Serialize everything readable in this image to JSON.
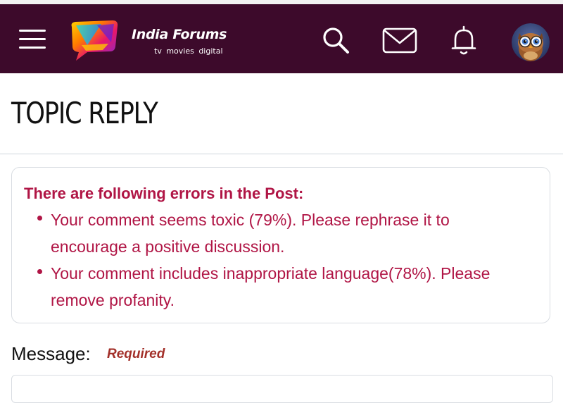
{
  "header": {
    "brand_name": "India Forums",
    "brand_tagline": "tv movies digital",
    "colors": {
      "background": "#3d0a2b",
      "icon": "#ffffff"
    },
    "icons": {
      "menu": "hamburger-menu-icon",
      "search": "search-icon",
      "messages": "mail-icon",
      "notifications": "bell-icon",
      "profile": "owl-avatar"
    }
  },
  "page": {
    "title": "TOPIC REPLY"
  },
  "errors": {
    "heading": "There are following errors in the Post:",
    "items": [
      "Your comment seems toxic (79%). Please rephrase it to encourage a positive discussion.",
      "Your comment includes inappropriate language(78%). Please remove profanity."
    ],
    "color": "#b01545"
  },
  "form": {
    "message_label": "Message:",
    "required_label": "Required"
  }
}
